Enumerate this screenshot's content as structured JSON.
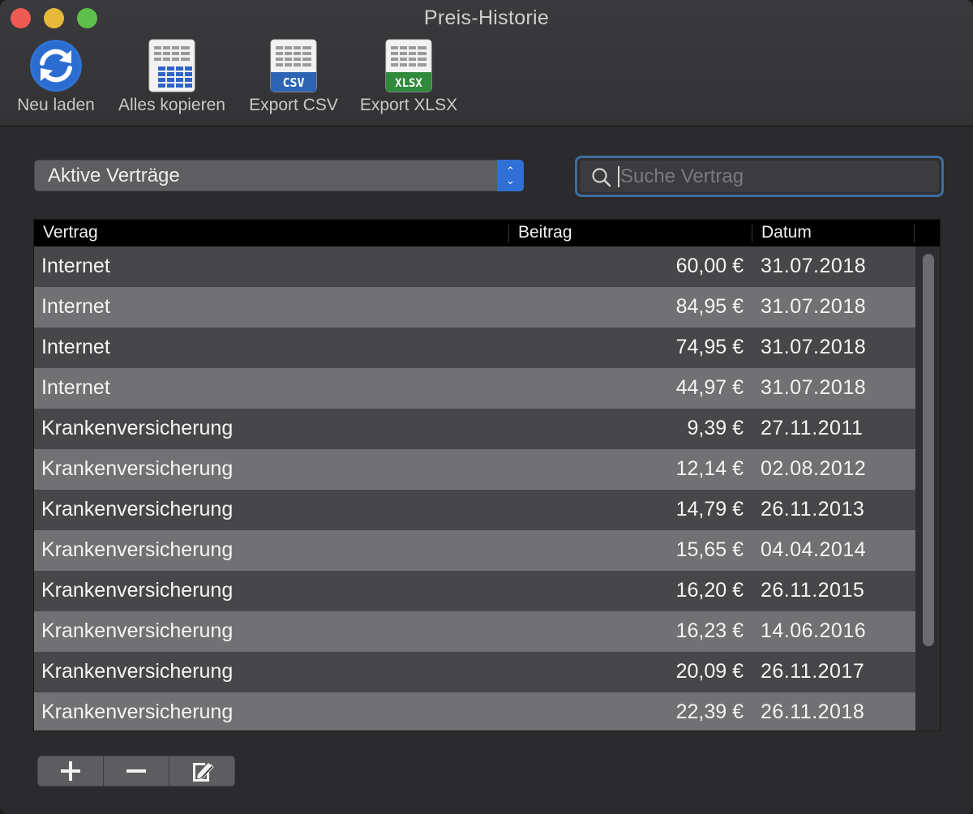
{
  "window": {
    "title": "Preis-Historie"
  },
  "toolbar": {
    "reload_label": "Neu laden",
    "copy_all_label": "Alles kopieren",
    "export_csv_label": "Export CSV",
    "export_csv_badge": "CSV",
    "export_xlsx_label": "Export XLSX",
    "export_xlsx_badge": "XLSX"
  },
  "filter": {
    "selected": "Aktive Verträge"
  },
  "search": {
    "placeholder": "Suche Vertrag",
    "value": ""
  },
  "table": {
    "columns": [
      "Vertrag",
      "Beitrag",
      "Datum"
    ],
    "rows": [
      {
        "vertrag": "Internet",
        "beitrag": "60,00 €",
        "datum": "31.07.2018"
      },
      {
        "vertrag": "Internet",
        "beitrag": "84,95 €",
        "datum": "31.07.2018"
      },
      {
        "vertrag": "Internet",
        "beitrag": "74,95 €",
        "datum": "31.07.2018"
      },
      {
        "vertrag": "Internet",
        "beitrag": "44,97 €",
        "datum": "31.07.2018"
      },
      {
        "vertrag": "Krankenversicherung",
        "beitrag": "9,39 €",
        "datum": "27.11.2011"
      },
      {
        "vertrag": "Krankenversicherung",
        "beitrag": "12,14 €",
        "datum": "02.08.2012"
      },
      {
        "vertrag": "Krankenversicherung",
        "beitrag": "14,79 €",
        "datum": "26.11.2013"
      },
      {
        "vertrag": "Krankenversicherung",
        "beitrag": "15,65 €",
        "datum": "04.04.2014"
      },
      {
        "vertrag": "Krankenversicherung",
        "beitrag": "16,20 €",
        "datum": "26.11.2015"
      },
      {
        "vertrag": "Krankenversicherung",
        "beitrag": "16,23 €",
        "datum": "14.06.2016"
      },
      {
        "vertrag": "Krankenversicherung",
        "beitrag": "20,09 €",
        "datum": "26.11.2017"
      },
      {
        "vertrag": "Krankenversicherung",
        "beitrag": "22,39 €",
        "datum": "26.11.2018"
      }
    ]
  },
  "bottom_buttons": {
    "add": "+",
    "remove": "−",
    "edit_icon": "edit-note-icon"
  },
  "colors": {
    "accent": "#2f6fd6",
    "focus_ring": "#3e6d9c",
    "csv_badge": "#2e64b4",
    "xlsx_badge": "#2f8a3c"
  }
}
